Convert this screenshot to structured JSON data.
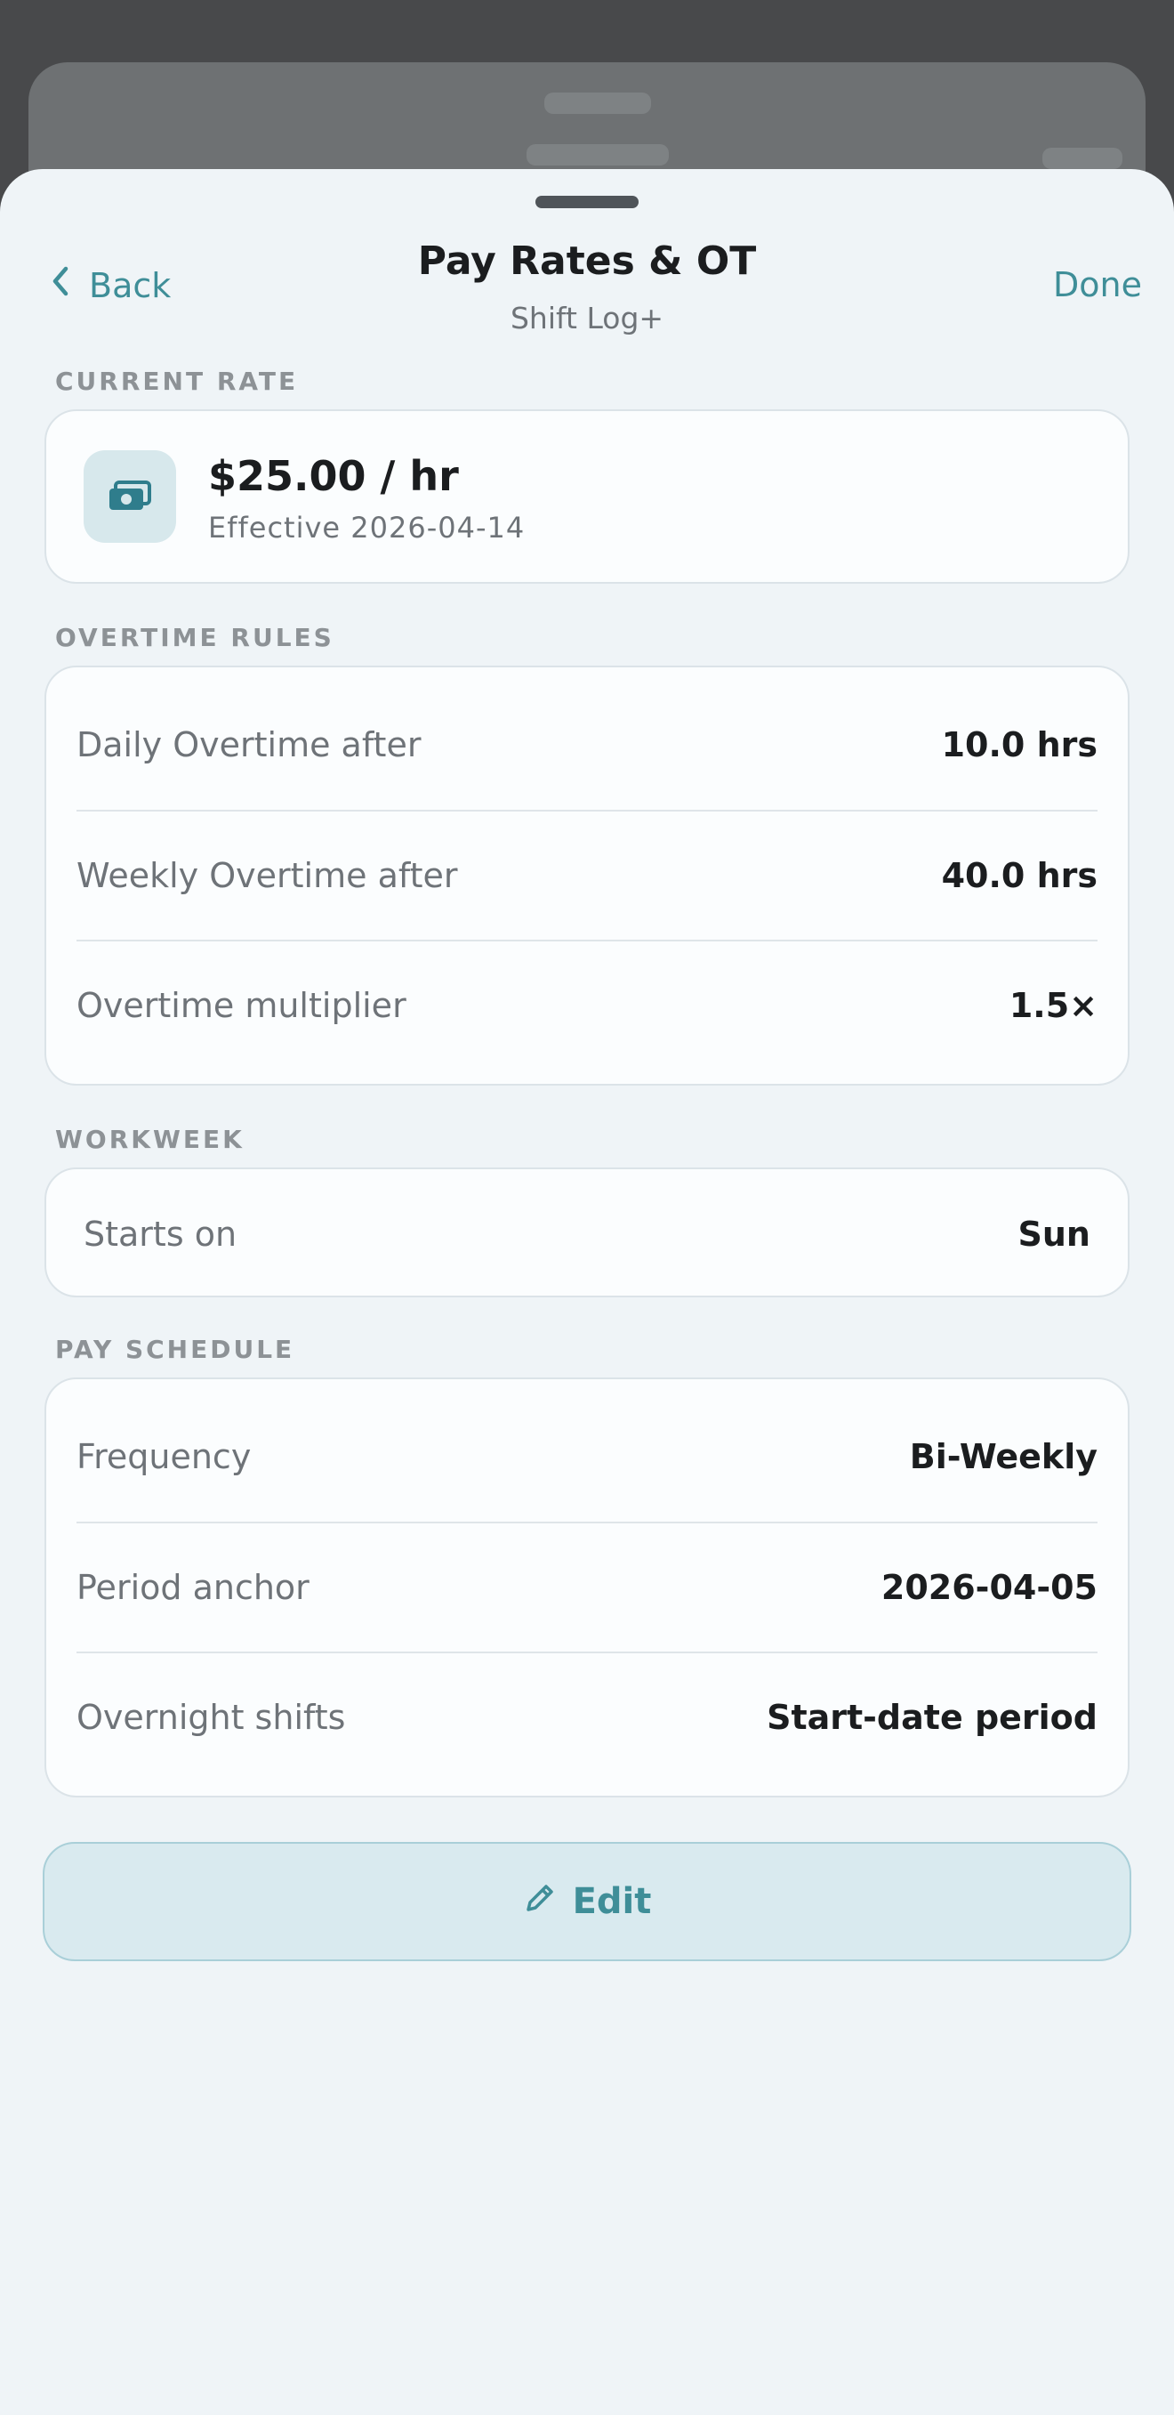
{
  "nav": {
    "back_label": "Back",
    "title": "Pay Rates & OT",
    "subtitle": "Shift Log+",
    "done_label": "Done"
  },
  "current_rate": {
    "section_label": "CURRENT RATE",
    "icon": "money-icon",
    "rate": "$25.00 / hr",
    "effective": "Effective 2026-04-14"
  },
  "overtime_rules": {
    "section_label": "OVERTIME RULES",
    "rows": [
      {
        "label": "Daily Overtime after",
        "value": "10.0 hrs"
      },
      {
        "label": "Weekly Overtime after",
        "value": "40.0 hrs"
      },
      {
        "label": "Overtime multiplier",
        "value": "1.5×"
      }
    ]
  },
  "workweek": {
    "section_label": "WORKWEEK",
    "rows": [
      {
        "label": "Starts on",
        "value": "Sun"
      }
    ]
  },
  "pay_schedule": {
    "section_label": "PAY SCHEDULE",
    "rows": [
      {
        "label": "Frequency",
        "value": "Bi-Weekly"
      },
      {
        "label": "Period anchor",
        "value": "2026-04-05"
      },
      {
        "label": "Overnight shifts",
        "value": "Start-date period"
      }
    ]
  },
  "edit_button": {
    "label": "Edit",
    "icon": "pencil-icon"
  },
  "colors": {
    "accent": "#3f8e98",
    "sheet_background": "#eff4f7",
    "card_background": "#fbfdfe"
  }
}
